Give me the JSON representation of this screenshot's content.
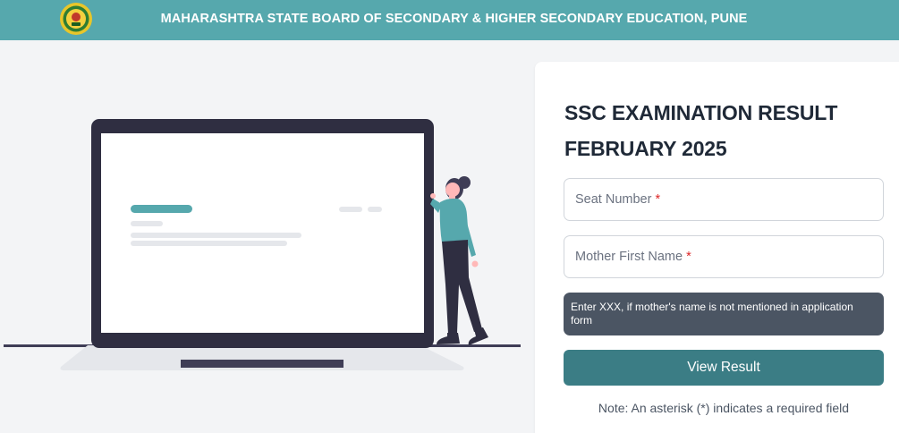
{
  "header": {
    "title": "MAHARASHTRA STATE BOARD OF SECONDARY & HIGHER SECONDARY EDUCATION, PUNE",
    "logo_icon": "board-emblem-icon",
    "background_color": "#56a8ad"
  },
  "form": {
    "title_line1": "SSC EXAMINATION RESULT",
    "title_line2": "FEBRUARY 2025",
    "seat_number_label": "Seat Number",
    "mother_name_label": "Mother First Name",
    "required_marker": "*",
    "hint": "Enter XXX, if mother's name is not mentioned in application form",
    "submit_label": "View Result",
    "note": "Note: An asterisk (*) indicates a required field"
  },
  "colors": {
    "accent": "#56a8ad",
    "button": "#3b7d85",
    "hint_background": "#4b5563",
    "required": "#dc2626"
  }
}
